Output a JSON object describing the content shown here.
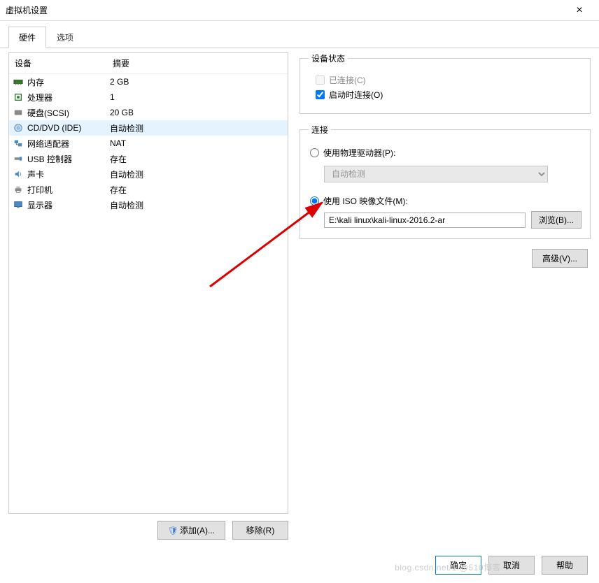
{
  "window": {
    "title": "虚拟机设置",
    "close": "×"
  },
  "tabs": {
    "hardware": "硬件",
    "options": "选项"
  },
  "list": {
    "headers": {
      "device": "设备",
      "summary": "摘要"
    },
    "items": [
      {
        "label": "内存",
        "summary": "2 GB"
      },
      {
        "label": "处理器",
        "summary": "1"
      },
      {
        "label": "硬盘(SCSI)",
        "summary": "20 GB"
      },
      {
        "label": "CD/DVD (IDE)",
        "summary": "自动检测"
      },
      {
        "label": "网络适配器",
        "summary": "NAT"
      },
      {
        "label": "USB 控制器",
        "summary": "存在"
      },
      {
        "label": "声卡",
        "summary": "自动检测"
      },
      {
        "label": "打印机",
        "summary": "存在"
      },
      {
        "label": "显示器",
        "summary": "自动检测"
      }
    ]
  },
  "buttons": {
    "add": "添加(A)...",
    "remove": "移除(R)"
  },
  "right": {
    "status": {
      "legend": "设备状态",
      "connected": "已连接(C)",
      "connect_on_start": "启动时连接(O)"
    },
    "connection": {
      "legend": "连接",
      "physical": "使用物理驱动器(P):",
      "auto_detect": "自动检测",
      "iso": "使用 ISO 映像文件(M):",
      "iso_path": "E:\\kali linux\\kali-linux-2016.2-ar",
      "browse": "浏览(B)..."
    },
    "advanced": "高级(V)..."
  },
  "footer": {
    "ok": "确定",
    "cancel": "取消",
    "help": "帮助"
  },
  "watermark": "blog.csdn.net/1.@510博客"
}
